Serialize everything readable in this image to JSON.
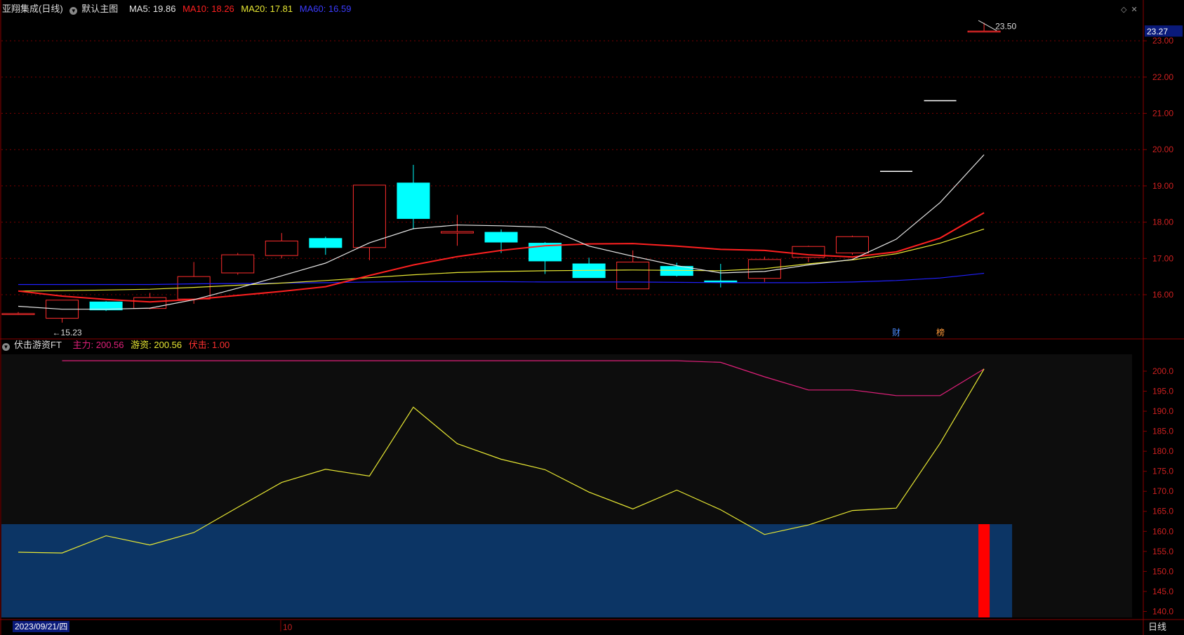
{
  "main_header": {
    "stock": "亚翔集成(日线)",
    "template": "默认主图",
    "ma5": "MA5: 19.86",
    "ma10": "MA10: 18.26",
    "ma20": "MA20: 17.81",
    "ma60": "MA60: 16.59"
  },
  "sub_header": {
    "indicator": "伏击游资FT",
    "main_force": "主力: 200.56",
    "hot_money": "游资: 200.56",
    "ambush": "伏击: 1.00"
  },
  "bottom_bar": {
    "date": "2023/09/21/四",
    "month_tick": "10",
    "period": "日线"
  },
  "markers": {
    "cai": "财",
    "bang": "榜",
    "high_label": "23.50",
    "low_label": "15.23",
    "last_price": "23.27"
  },
  "colors": {
    "up": "#ff2d2d",
    "down": "#00ffff",
    "ma5": "#e6e6e6",
    "ma10": "#ff2020",
    "ma20": "#e8e833",
    "ma60": "#2020ff",
    "main_force": "#e0207a",
    "hot_money": "#e8e833",
    "ambush_box": "#0c3565",
    "ambush_bar": "#ff0000",
    "grid": "#7a0000",
    "axis_text": "#d02020"
  },
  "chart_data": [
    {
      "type": "candlestick",
      "title": "亚翔集成(日线)",
      "y_ticks": [
        16.0,
        17.0,
        18.0,
        19.0,
        20.0,
        21.0,
        22.0,
        23.0
      ],
      "ylim": [
        14.8,
        23.7
      ],
      "candles": [
        {
          "o": 15.48,
          "h": 15.52,
          "c": 15.48,
          "l": 15.44
        },
        {
          "o": 15.35,
          "h": 15.85,
          "c": 15.85,
          "l": 15.23
        },
        {
          "o": 15.8,
          "h": 15.82,
          "c": 15.58,
          "l": 15.55
        },
        {
          "o": 15.62,
          "h": 16.05,
          "c": 15.92,
          "l": 15.6
        },
        {
          "o": 15.88,
          "h": 16.9,
          "c": 16.5,
          "l": 15.75
        },
        {
          "o": 16.6,
          "h": 17.15,
          "c": 17.1,
          "l": 16.55
        },
        {
          "o": 17.08,
          "h": 17.7,
          "c": 17.48,
          "l": 17.0
        },
        {
          "o": 17.55,
          "h": 17.6,
          "c": 17.3,
          "l": 17.1
        },
        {
          "o": 17.3,
          "h": 19.02,
          "c": 19.02,
          "l": 16.95
        },
        {
          "o": 19.08,
          "h": 19.58,
          "c": 18.1,
          "l": 17.8
        },
        {
          "o": 17.7,
          "h": 18.2,
          "c": 17.74,
          "l": 17.35
        },
        {
          "o": 17.72,
          "h": 17.8,
          "c": 17.45,
          "l": 17.15
        },
        {
          "o": 17.42,
          "h": 17.45,
          "c": 16.93,
          "l": 16.57
        },
        {
          "o": 16.85,
          "h": 17.02,
          "c": 16.47,
          "l": 16.47
        },
        {
          "o": 16.16,
          "h": 17.22,
          "c": 16.9,
          "l": 16.16
        },
        {
          "o": 16.78,
          "h": 16.88,
          "c": 16.53,
          "l": 16.5
        },
        {
          "o": 16.38,
          "h": 16.85,
          "c": 16.35,
          "l": 16.2
        },
        {
          "o": 16.45,
          "h": 17.05,
          "c": 16.97,
          "l": 16.35
        },
        {
          "o": 17.03,
          "h": 17.35,
          "c": 17.33,
          "l": 16.9
        },
        {
          "o": 17.15,
          "h": 17.63,
          "c": 17.6,
          "l": 17.1
        },
        {
          "o": 19.4,
          "h": 19.4,
          "c": 19.4,
          "l": 19.4
        },
        {
          "o": 21.35,
          "h": 21.35,
          "c": 21.35,
          "l": 21.35
        },
        {
          "o": 23.27,
          "h": 23.5,
          "c": 23.27,
          "l": 23.27
        }
      ],
      "ma5": [
        15.68,
        15.6,
        15.6,
        15.63,
        15.86,
        16.18,
        16.52,
        16.87,
        17.43,
        17.82,
        17.92,
        17.9,
        17.86,
        17.34,
        17.06,
        16.8,
        16.6,
        16.64,
        16.82,
        16.97,
        17.53,
        18.54,
        19.86
      ],
      "ma10": [
        16.1,
        15.96,
        15.87,
        15.8,
        15.87,
        15.98,
        16.09,
        16.22,
        16.53,
        16.82,
        17.05,
        17.22,
        17.35,
        17.4,
        17.41,
        17.34,
        17.25,
        17.22,
        17.1,
        17.04,
        17.18,
        17.56,
        18.26
      ],
      "ma20": [
        16.1,
        16.11,
        16.13,
        16.15,
        16.2,
        16.26,
        16.32,
        16.39,
        16.47,
        16.55,
        16.61,
        16.64,
        16.66,
        16.67,
        16.68,
        16.67,
        16.66,
        16.72,
        16.85,
        16.96,
        17.13,
        17.42,
        17.81
      ],
      "ma60": [
        16.28,
        16.28,
        16.28,
        16.28,
        16.3,
        16.31,
        16.32,
        16.33,
        16.35,
        16.36,
        16.36,
        16.36,
        16.35,
        16.35,
        16.35,
        16.34,
        16.33,
        16.33,
        16.33,
        16.35,
        16.39,
        16.46,
        16.59
      ]
    },
    {
      "type": "line",
      "title": "伏击游资FT",
      "y_ticks": [
        140.0,
        145.0,
        150.0,
        155.0,
        160.0,
        165.0,
        170.0,
        175.0,
        180.0,
        185.0,
        190.0,
        195.0,
        200.0
      ],
      "ylim": [
        138.5,
        204.2
      ],
      "series": [
        {
          "name": "主力",
          "values": [
            null,
            202.6,
            202.6,
            202.6,
            202.6,
            202.6,
            202.6,
            202.6,
            202.6,
            202.6,
            202.6,
            202.6,
            202.6,
            202.6,
            202.6,
            202.6,
            202.2,
            198.6,
            195.3,
            195.3,
            193.9,
            193.9,
            200.56
          ]
        },
        {
          "name": "游资",
          "values": [
            154.8,
            154.6,
            158.9,
            156.6,
            159.7,
            166.0,
            172.2,
            175.5,
            173.8,
            191.0,
            181.9,
            178.0,
            175.4,
            169.8,
            165.6,
            170.3,
            165.4,
            159.2,
            161.6,
            165.2,
            165.8,
            182.0,
            200.56
          ]
        }
      ],
      "ambush_box": {
        "top": 161.8,
        "bottom": 138.5
      },
      "ambush_signal": {
        "index": 22,
        "value": 1.0
      }
    }
  ]
}
